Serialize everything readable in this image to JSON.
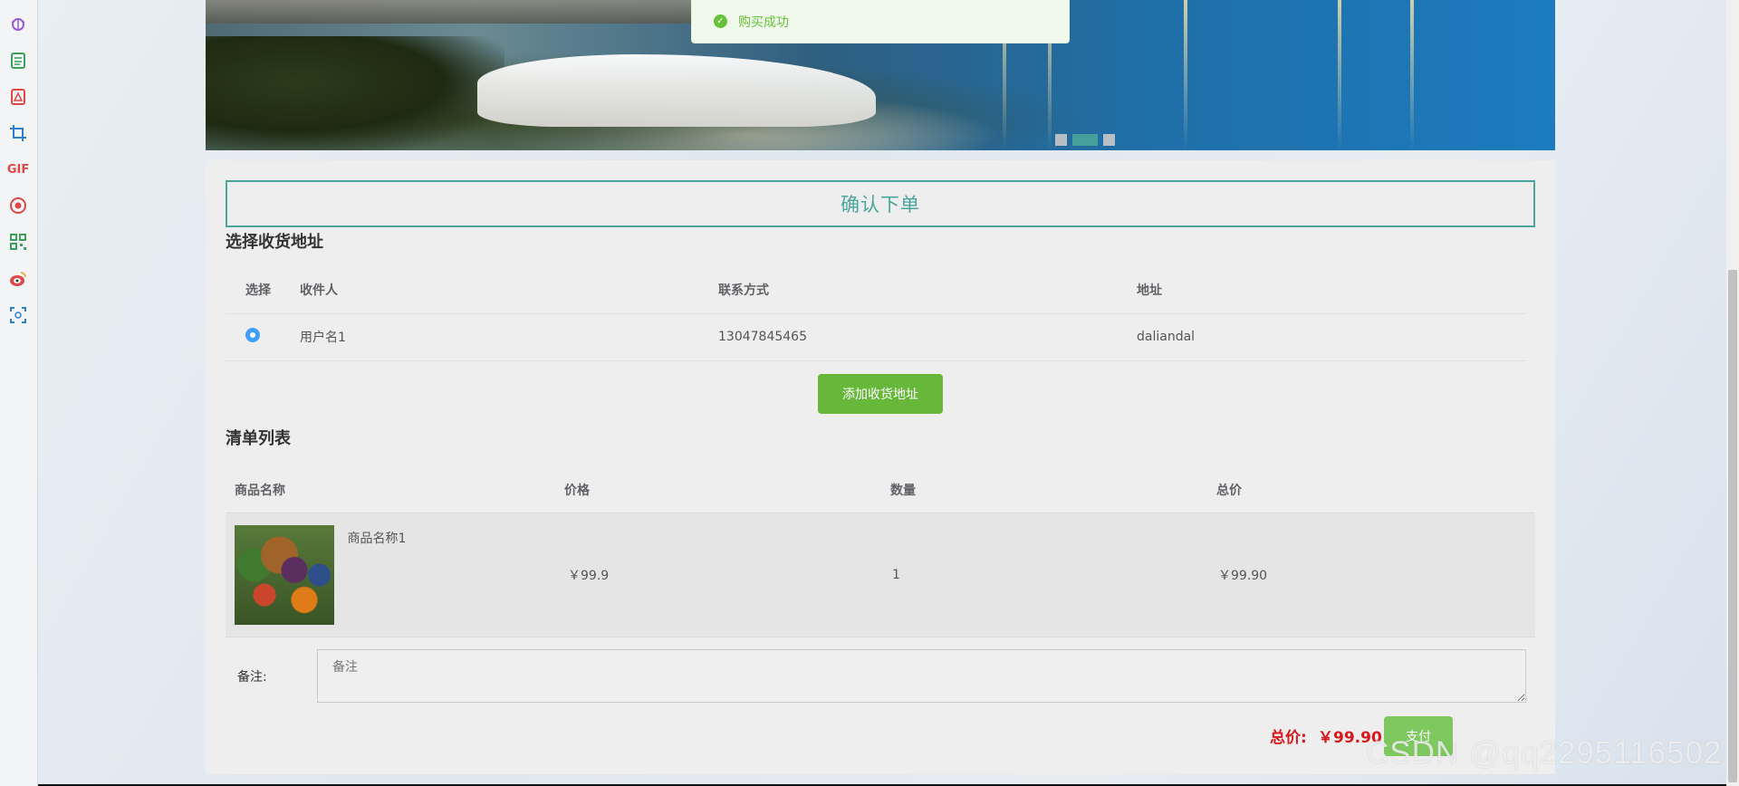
{
  "toast": {
    "message": "购买成功",
    "icon": "check-circle-icon"
  },
  "banner": {
    "slides": 3,
    "active_slide": 2
  },
  "order": {
    "title": "确认下单",
    "address_section_title": "选择收货地址",
    "address_columns": [
      "选择",
      "收件人",
      "联系方式",
      "地址"
    ],
    "addresses": [
      {
        "selected": true,
        "recipient": "用户名1",
        "phone": "13047845465",
        "address": "daliandal"
      }
    ],
    "add_address_label": "添加收货地址",
    "list_section_title": "清单列表",
    "goods_columns": [
      "商品名称",
      "价格",
      "数量",
      "总价"
    ],
    "goods": [
      {
        "name": "商品名称1",
        "price": "￥99.9",
        "quantity": "1",
        "subtotal": "￥99.90"
      }
    ],
    "remark_label": "备注:",
    "remark_placeholder": "备注",
    "total_label": "总价:",
    "total_value": "￥99.90",
    "pay_label": "支付"
  },
  "watermark": "CSDN @qq2295116502",
  "colors": {
    "accent": "#4aa59a",
    "success": "#67c23a",
    "total": "#d9181d",
    "button_green": "#67b73a"
  }
}
